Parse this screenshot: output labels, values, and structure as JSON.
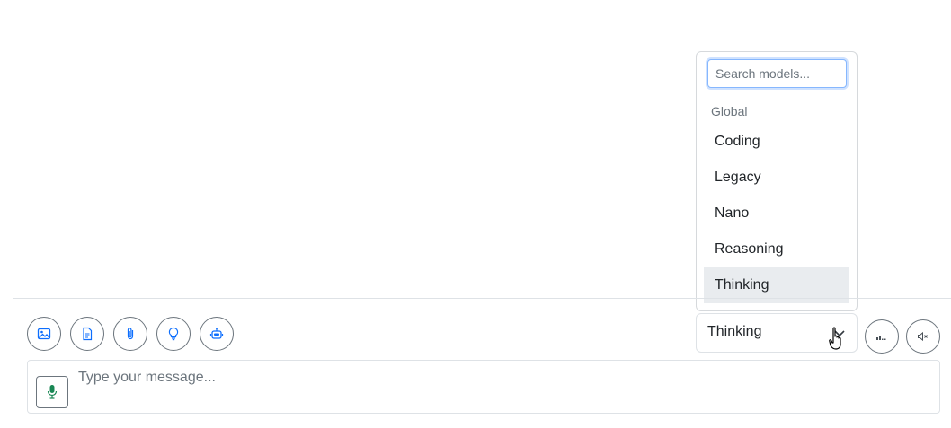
{
  "toolbar": {
    "buttons": [
      {
        "name": "image-upload-button",
        "icon": "image-icon"
      },
      {
        "name": "document-button",
        "icon": "document-icon"
      },
      {
        "name": "attach-button",
        "icon": "paperclip-icon"
      },
      {
        "name": "idea-button",
        "icon": "lightbulb-icon"
      },
      {
        "name": "bot-button",
        "icon": "robot-icon"
      }
    ],
    "icon_color": "#0d6efd"
  },
  "model_selector": {
    "selected": "Thinking",
    "dropdown": {
      "search_placeholder": "Search models...",
      "search_value": "",
      "group_label": "Global",
      "items": [
        "Coding",
        "Legacy",
        "Nano",
        "Reasoning",
        "Thinking"
      ],
      "highlighted_index": 4
    }
  },
  "right_controls": [
    {
      "name": "audio-level-button",
      "icon": "audio-bars-icon"
    },
    {
      "name": "mute-button",
      "icon": "speaker-mute-icon"
    }
  ],
  "composer": {
    "placeholder": "Type your message...",
    "value": "",
    "mic_icon": "microphone-icon",
    "mic_color": "#198754"
  }
}
